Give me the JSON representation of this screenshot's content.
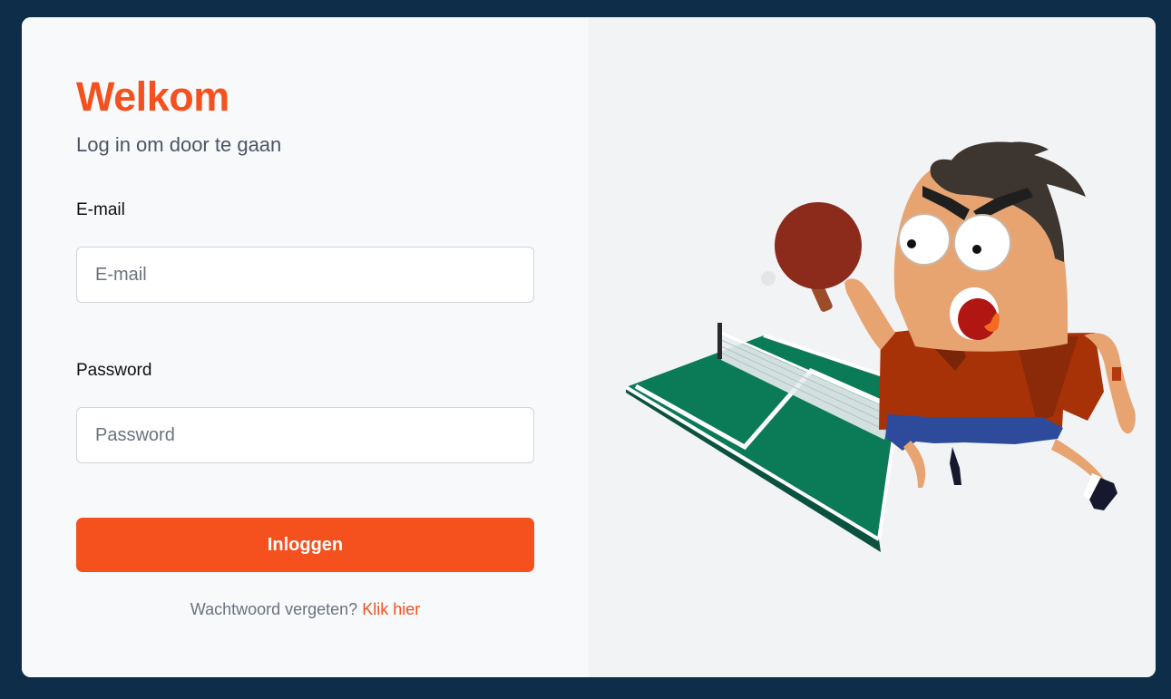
{
  "login": {
    "title": "Welkom",
    "subtitle": "Log in om door te gaan",
    "email_label": "E-mail",
    "email_placeholder": "E-mail",
    "email_value": "",
    "password_label": "Password",
    "password_placeholder": "Password",
    "password_value": "",
    "submit_label": "Inloggen",
    "forgot_text": "Wachtwoord vergeten?",
    "forgot_link": "Klik hier"
  },
  "illustration": {
    "icon": "ping-pong-player-illustration"
  },
  "colors": {
    "background": "#0d2d48",
    "accent": "#f4511e",
    "left_panel": "#f7f9fb",
    "right_panel": "#f2f3f5"
  }
}
